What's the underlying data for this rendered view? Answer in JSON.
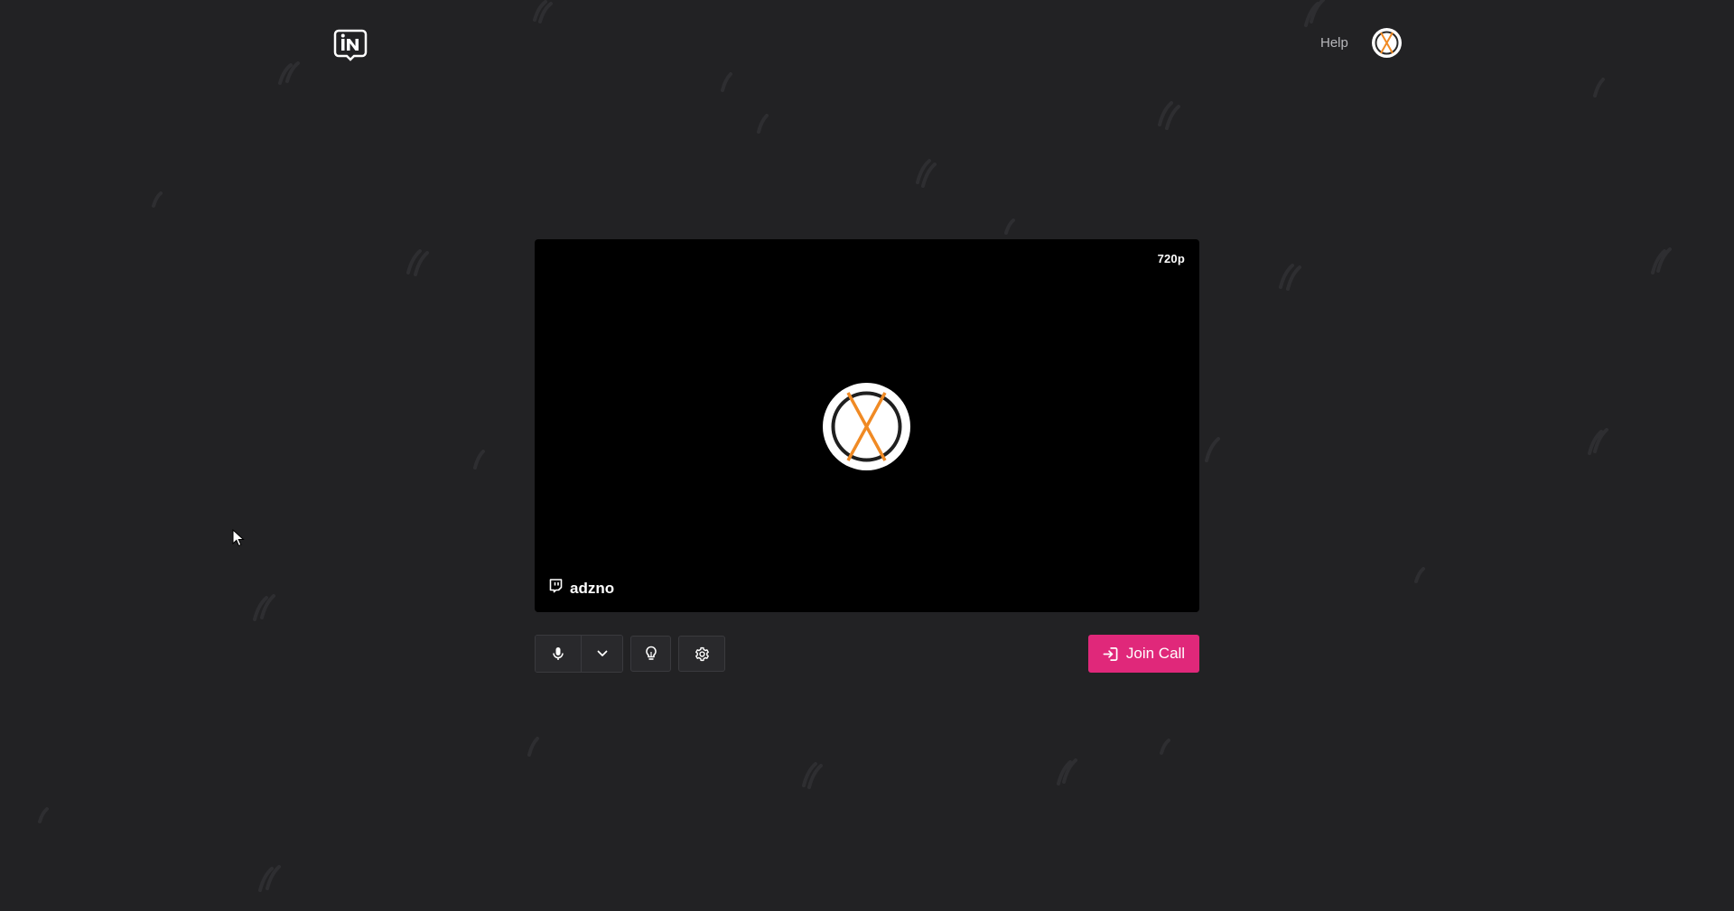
{
  "header": {
    "logo_icon": "brand-logo-icon",
    "help_label": "Help",
    "avatar_icon": "user-avatar"
  },
  "preview": {
    "quality_label": "720p",
    "username": "adzno",
    "platform_icon": "twitch-icon"
  },
  "controls": {
    "mic_icon": "microphone-icon",
    "device_dropdown_icon": "chevron-down-icon",
    "effects_icon": "lightbulb-icon",
    "settings_icon": "gear-icon",
    "join_label": "Join Call",
    "join_icon": "enter-icon"
  },
  "colors": {
    "background": "#222224",
    "preview_bg": "#000000",
    "accent": "#e0287a",
    "avatar_orange": "#f08a24",
    "muted_text": "#b8b8bc"
  }
}
